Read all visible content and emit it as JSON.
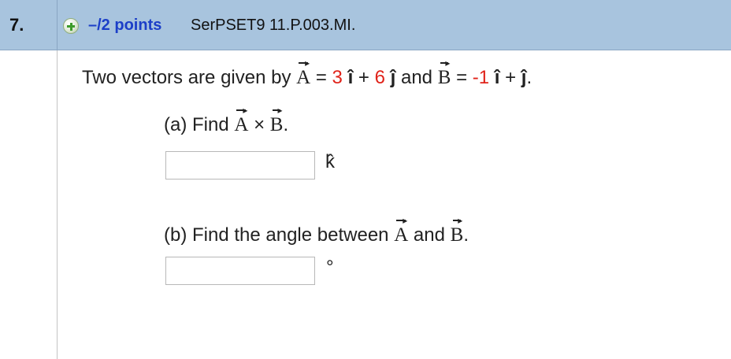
{
  "header": {
    "question_number": "7.",
    "points": "–/2 points",
    "problem_id": "SerPSET9 11.P.003.MI."
  },
  "problem": {
    "intro": "Two vectors are given by",
    "vector_a": "A",
    "eq": "=",
    "a_i_coef": "3",
    "i_hat": "î",
    "plus": "+",
    "a_j_coef": "6",
    "j_hat": "ĵ",
    "and": "and",
    "vector_b": "B",
    "b_i_coef": "-1",
    "end": "."
  },
  "part_a": {
    "prefix": "(a) Find",
    "times": "×",
    "end": ".",
    "answer_value": "",
    "unit": "k̂"
  },
  "part_b": {
    "prefix": "(b) Find the angle between",
    "and": "and",
    "end": ".",
    "answer_value": "",
    "unit": "°"
  },
  "icons": {
    "expand": "plus-circle-icon",
    "vector_arrow": "vector-arrow-icon"
  },
  "colors": {
    "header_bg": "#a8c4de",
    "points_text": "#1c3fc8",
    "coefficient_red": "#e0231a",
    "plus_icon_green": "#3d9b2a"
  }
}
